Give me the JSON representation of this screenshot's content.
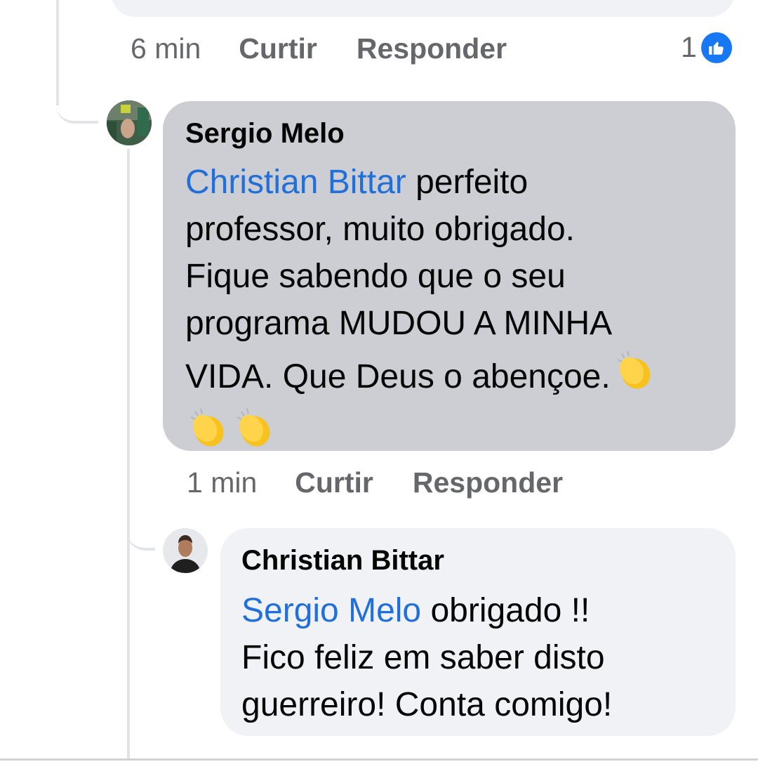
{
  "previous_comment": {
    "time": "6 min",
    "like_label": "Curtir",
    "reply_label": "Responder",
    "reaction_count": "1",
    "reaction_icon": "thumbs-up-icon"
  },
  "comment_1": {
    "author": "Sergio Melo",
    "mention": "Christian Bittar",
    "text_line_1": " perfeito",
    "text_line_2": "professor, muito obrigado.",
    "text_line_3": "Fique sabendo que o seu",
    "text_line_4": "programa MUDOU A MINHA",
    "text_line_5": "VIDA. Que Deus o abençoe.",
    "emoji": "clapping-hands-icon",
    "time": "1 min",
    "like_label": "Curtir",
    "reply_label": "Responder"
  },
  "comment_2": {
    "author": "Christian Bittar",
    "mention": "Sergio Melo",
    "text_line_1": " obrigado !!",
    "text_line_2": "Fico feliz em saber disto",
    "text_line_3": "guerreiro! Conta comigo!"
  },
  "colors": {
    "mention": "#216fdb",
    "meta_text": "#65676b",
    "highlight_bubble": "#ccced3",
    "bubble": "#f0f2f5",
    "like_blue": "#1877f2"
  }
}
